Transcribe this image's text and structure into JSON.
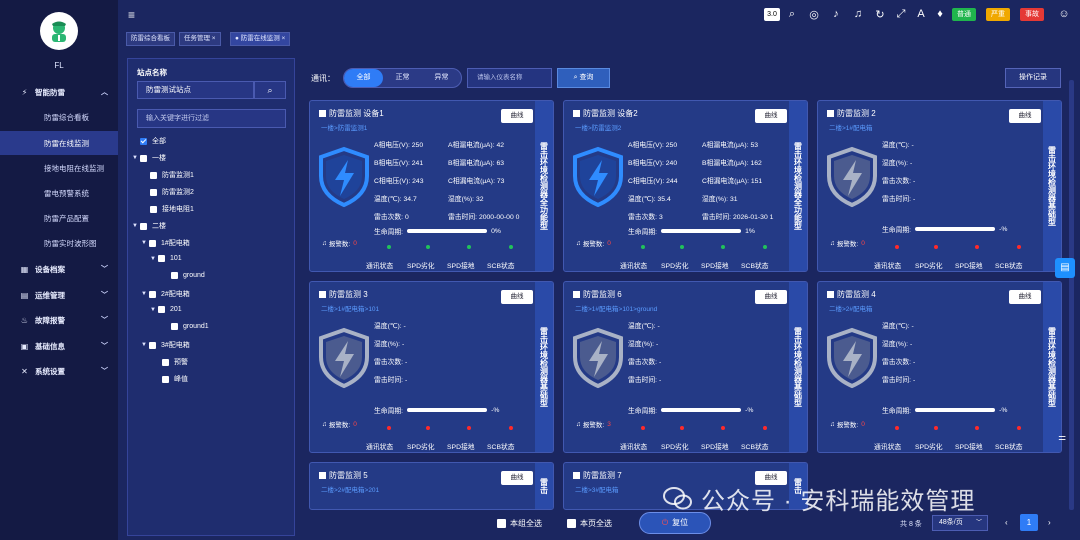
{
  "user": {
    "name": "FL"
  },
  "nav": {
    "group_smart": "智能防雷",
    "items": [
      "防雷综合看板",
      "防雷在线监测",
      "接地电阻在线监测",
      "雷电预警系统",
      "防雷产品配置",
      "防雷实时波形图"
    ],
    "groups": [
      "设备档案",
      "运维管理",
      "故障报警",
      "基础信息",
      "系统设置"
    ]
  },
  "topbar": {
    "version": "3.0",
    "badge_ok": "普通",
    "badge_severe": "严重",
    "badge_event": "事故"
  },
  "tabs": [
    "防雷综合看板",
    "任务管理 ×",
    "● 防雷在线监测 ×"
  ],
  "tree": {
    "label": "站点名称",
    "site": "防雷测试站点",
    "filter_placeholder": "输入关键字进行过滤",
    "nodes": [
      "全部",
      "一楼",
      "防雷监测1",
      "防雷监测2",
      "接地电阻1",
      "二楼",
      "1#配电箱",
      "101",
      "ground",
      "2#配电箱",
      "201",
      "ground1",
      "3#配电箱",
      "预警",
      "峰值"
    ]
  },
  "filterbar": {
    "label": "通讯：",
    "seg_all": "全部",
    "seg_normal": "正常",
    "seg_abnormal": "异常",
    "device_placeholder": "请输入仪表名称",
    "query": "查询",
    "log": "操作记录"
  },
  "card_common": {
    "curve": "曲线",
    "alarm_label": "报警数:",
    "life_label": "生命周期:",
    "status": [
      "通讯状态",
      "SPD劣化",
      "SPD接地",
      "SCB状态"
    ],
    "side_full": "雷击环境检测器全功能型",
    "side_basic": "雷击环境检测器基础型"
  },
  "cards": [
    {
      "title": "防雷监测 设备1",
      "path": "一楼>防雷监测1",
      "side": "雷击环境检测器全功能型",
      "alarm": "0",
      "life": "0%",
      "rows": [
        [
          "A相电压(V):  250",
          "A相漏电流(μA):  42"
        ],
        [
          "B相电压(V):  241",
          "B相漏电流(μA):  63"
        ],
        [
          "C相电压(V):  243",
          "C相漏电流(μA):  73"
        ],
        [
          "温度(℃):  34.7",
          "湿度(%):  32"
        ],
        [
          "雷击次数:  0",
          "雷击时间:  2000-00-00 0"
        ]
      ]
    },
    {
      "title": "防雷监测 设备2",
      "path": "一楼>防雷监测2",
      "side": "雷击环境检测器全功能型",
      "alarm": "0",
      "life": "1%",
      "rows": [
        [
          "A相电压(V):  250",
          "A相漏电流(μA):  53"
        ],
        [
          "B相电压(V):  240",
          "B相漏电流(μA):  162"
        ],
        [
          "C相电压(V):  244",
          "C相漏电流(μA):  151"
        ],
        [
          "温度(℃):  35.4",
          "湿度(%):  31"
        ],
        [
          "雷击次数:  3",
          "雷击时间:  2026-01-30 1"
        ]
      ]
    },
    {
      "title": "防雷监测 2",
      "path": "二楼>1#配电箱",
      "side": "雷击环境检测器基础型",
      "alarm": "0",
      "life": "-%",
      "rows": [
        [
          "温度(℃):  -"
        ],
        [
          "湿度(%):  -"
        ],
        [
          "雷击次数:  -"
        ],
        [
          "雷击时间:  -"
        ]
      ]
    },
    {
      "title": "防雷监测 3",
      "path": "二楼>1#配电箱>101",
      "side": "雷击环境检测器基础型",
      "alarm": "0",
      "life": "-%",
      "rows": [
        [
          "温度(℃):  -"
        ],
        [
          "湿度(%):  -"
        ],
        [
          "雷击次数:  -"
        ],
        [
          "雷击时间:  -"
        ]
      ]
    },
    {
      "title": "防雷监测 6",
      "path": "二楼>1#配电箱>101>ground",
      "side": "雷击环境检测器基础型",
      "alarm": "3",
      "life": "-%",
      "rows": [
        [
          "温度(℃):  -"
        ],
        [
          "湿度(%):  -"
        ],
        [
          "雷击次数:  -"
        ],
        [
          "雷击时间:  -"
        ]
      ]
    },
    {
      "title": "防雷监测 4",
      "path": "二楼>2#配电箱",
      "side": "雷击环境检测器基础型",
      "alarm": "0",
      "life": "-%",
      "rows": [
        [
          "温度(℃):  -"
        ],
        [
          "湿度(%):  -"
        ],
        [
          "雷击次数:  -"
        ],
        [
          "雷击时间:  -"
        ]
      ]
    },
    {
      "title": "防雷监测 5",
      "path": "二楼>2#配电箱>201",
      "side": "雷击",
      "alarm": "",
      "life": "",
      "rows": []
    },
    {
      "title": "防雷监测 7",
      "path": "二楼>3#配电箱",
      "side": "雷击",
      "alarm": "",
      "life": "",
      "rows": []
    }
  ],
  "bottom": {
    "group_all": "本组全选",
    "page_all": "本页全选",
    "reset": "复位",
    "total": "共 8 条",
    "pagesize": "48条/页",
    "page": "1"
  },
  "watermark": "公众号 · 安科瑞能效管理",
  "colors": {
    "ok": "#21c25a",
    "alarm": "#ff2a2a",
    "accent": "#2f7cf6"
  }
}
